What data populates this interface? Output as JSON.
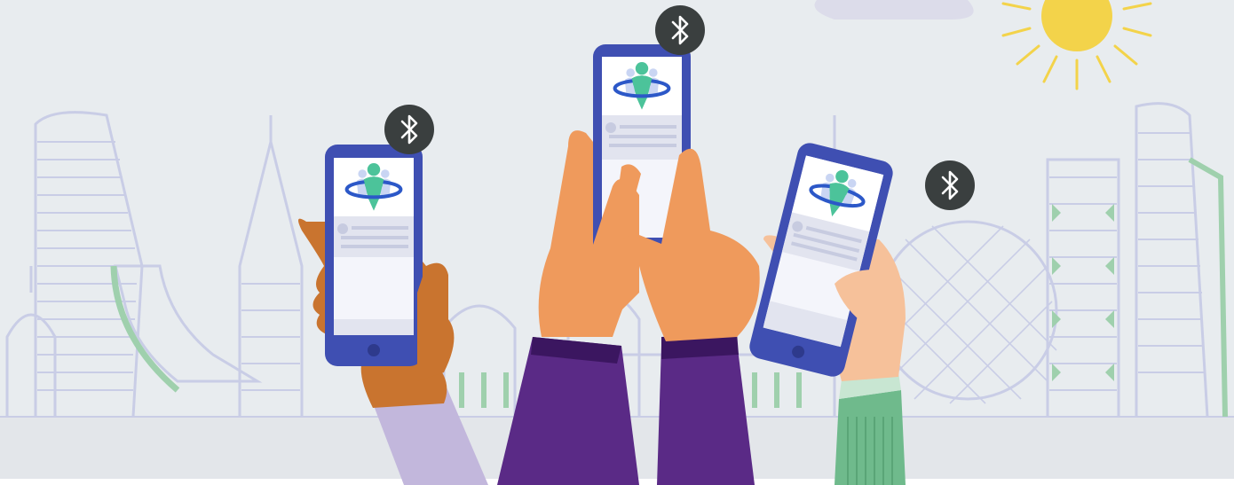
{
  "scene": {
    "sky_color": "#e8ecef",
    "ground_color": "#e3e6ea",
    "skyline_line_color": "#c9cde6",
    "accent_green": "#9fd0ad",
    "sun_color": "#f3d34a"
  },
  "phones": [
    {
      "id": "left",
      "body_color": "#3f4fb2",
      "screen_color": "#f4f5fb",
      "app_icon": "people-globe-icon"
    },
    {
      "id": "center",
      "body_color": "#3f4fb2",
      "screen_color": "#f4f5fb",
      "app_icon": "people-globe-icon"
    },
    {
      "id": "right",
      "body_color": "#3f4fb2",
      "screen_color": "#f4f5fb",
      "app_icon": "people-globe-icon"
    }
  ],
  "bluetooth_badges": [
    {
      "icon": "bluetooth-icon",
      "color": "#3a3f3f"
    },
    {
      "icon": "bluetooth-icon",
      "color": "#3a3f3f"
    },
    {
      "icon": "bluetooth-icon",
      "color": "#3a3f3f"
    }
  ],
  "colors": {
    "skin_tan": "#ef9a5c",
    "skin_dark": "#c9742f",
    "skin_light": "#f6c19a",
    "sleeve_lilac": "#c2b7dc",
    "sleeve_purple": "#5a2a86",
    "sleeve_purple_dark": "#3b1660",
    "sleeve_green": "#6fba8c",
    "logo_green": "#4cc39a",
    "logo_blue": "#2c58c8"
  }
}
